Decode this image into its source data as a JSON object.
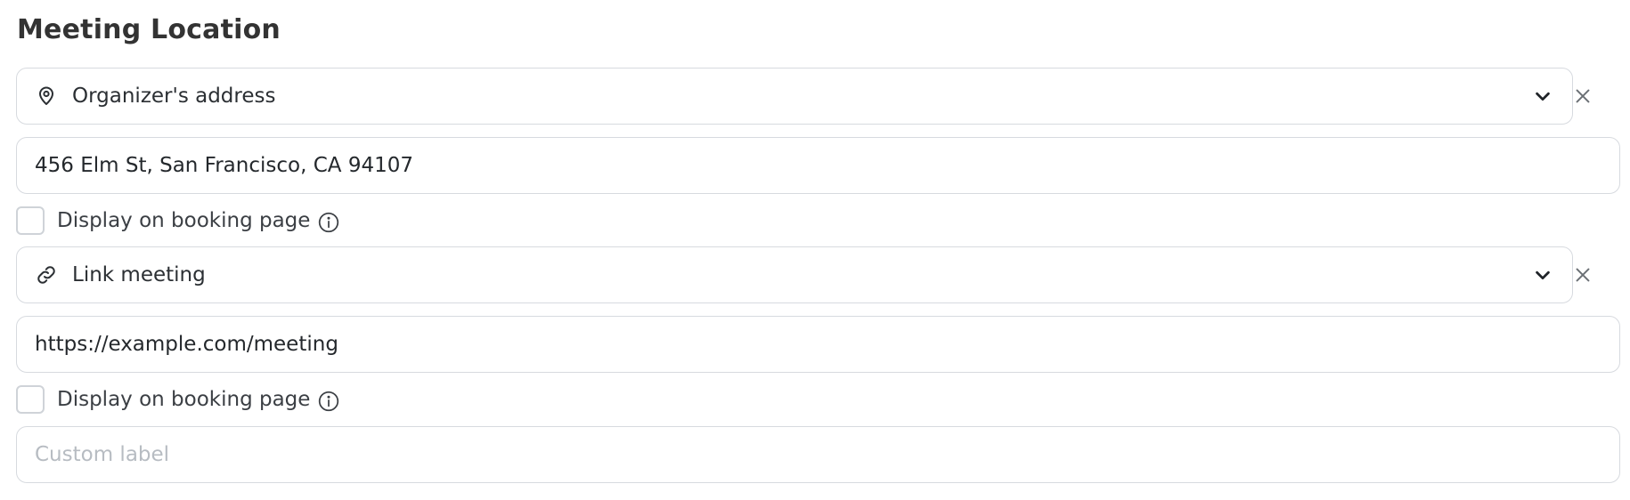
{
  "section": {
    "title": "Meeting Location"
  },
  "locations": [
    {
      "type_label": "Organizer's address",
      "icon": "map-pin-icon",
      "value": "456 Elm St, San Francisco, CA 94107",
      "display_label": "Display on booking page"
    },
    {
      "type_label": "Link meeting",
      "icon": "link-icon",
      "value": "https://example.com/meeting",
      "display_label": "Display on booking page"
    }
  ],
  "custom_label": {
    "placeholder": "Custom label",
    "value": ""
  },
  "colors": {
    "border": "#d7dadf",
    "text": "#2b2f33",
    "placeholder": "#b7bcc2",
    "icon": "#2b2f33",
    "close": "#6b7075"
  }
}
